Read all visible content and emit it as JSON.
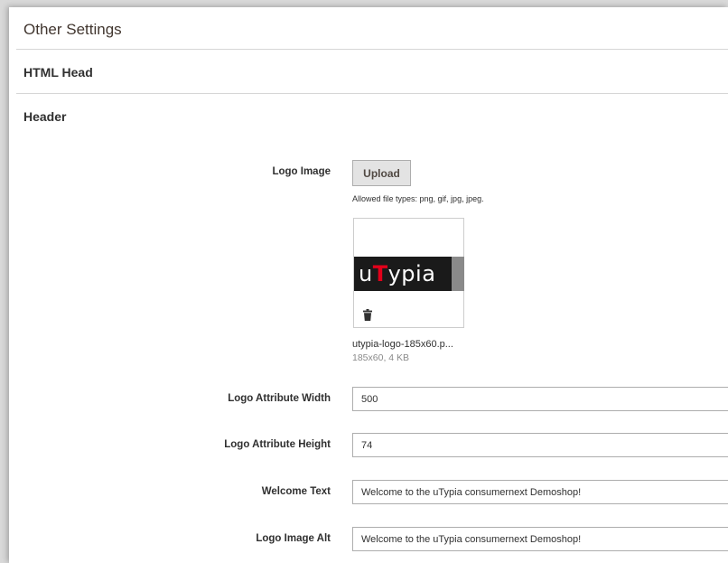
{
  "sections": {
    "other_settings": "Other Settings",
    "html_head": "HTML Head",
    "header": "Header"
  },
  "logo_image": {
    "label": "Logo Image",
    "upload_label": "Upload",
    "allowed_types": "Allowed file types: png, gif, jpg, jpeg.",
    "preview_logo": "uTypia",
    "preview_logo_parts": [
      "u",
      "T",
      "ypia"
    ],
    "file_name": "utypia-logo-185x60.p...",
    "file_meta": "185x60, 4 KB",
    "delete_icon": "trash-icon"
  },
  "fields": {
    "logo_width": {
      "label": "Logo Attribute Width",
      "value": "500"
    },
    "logo_height": {
      "label": "Logo Attribute Height",
      "value": "74"
    },
    "welcome_text": {
      "label": "Welcome Text",
      "value": "Welcome to the uTypia consumernext Demoshop!"
    },
    "logo_alt": {
      "label": "Logo Image Alt",
      "value": "Welcome to the uTypia consumernext Demoshop!"
    }
  },
  "colors": {
    "logo_background": "#1a1a1a",
    "logo_accent": "#e2001a",
    "button_background": "#e3e3e3"
  }
}
